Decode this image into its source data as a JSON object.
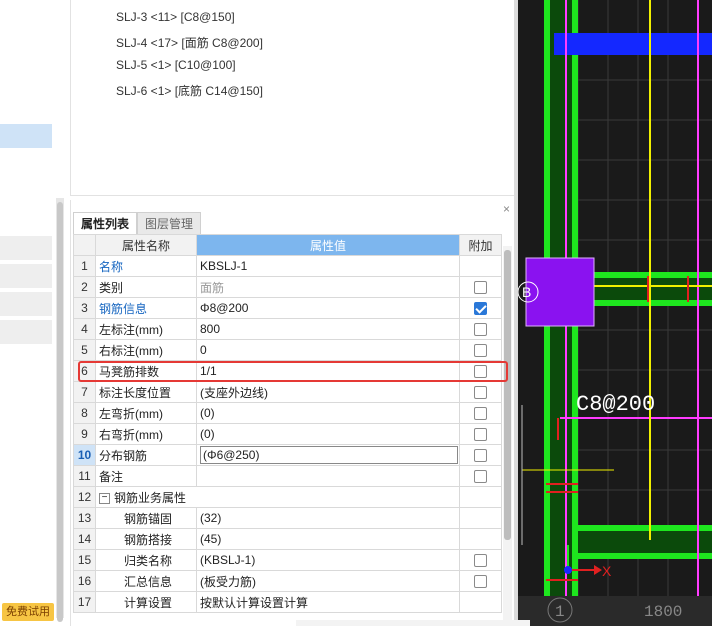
{
  "left_panel": {
    "trial_badge": "免费试用"
  },
  "rebar_list": {
    "items": [
      "SLJ-3 <11> [C8@150]",
      "SLJ-4 <17> [面筋 C8@200]",
      "SLJ-5 <1> [C10@100]",
      "SLJ-6 <1> [底筋 C14@150]"
    ]
  },
  "property_panel": {
    "close_label": "×",
    "tabs": {
      "properties": "属性列表",
      "layers": "图层管理"
    },
    "headers": {
      "name": "属性名称",
      "value": "属性值",
      "extra": "附加"
    },
    "rows": [
      {
        "num": "1",
        "name": "名称",
        "value": "KBSLJ-1",
        "checkbox": "none"
      },
      {
        "num": "2",
        "name": "类别",
        "value": "面筋",
        "checkbox": "unchecked"
      },
      {
        "num": "3",
        "name": "钢筋信息",
        "value": "Φ8@200",
        "checkbox": "checked"
      },
      {
        "num": "4",
        "name": "左标注(mm)",
        "value": "800",
        "checkbox": "unchecked"
      },
      {
        "num": "5",
        "name": "右标注(mm)",
        "value": "0",
        "checkbox": "unchecked"
      },
      {
        "num": "6",
        "name": "马凳筋排数",
        "value": "1/1",
        "checkbox": "unchecked"
      },
      {
        "num": "7",
        "name": "标注长度位置",
        "value": "(支座外边线)",
        "checkbox": "unchecked"
      },
      {
        "num": "8",
        "name": "左弯折(mm)",
        "value": "(0)",
        "checkbox": "unchecked"
      },
      {
        "num": "9",
        "name": "右弯折(mm)",
        "value": "(0)",
        "checkbox": "unchecked"
      },
      {
        "num": "10",
        "name": "分布钢筋",
        "value": "(Φ6@250)",
        "checkbox": "unchecked"
      },
      {
        "num": "11",
        "name": "备注",
        "value": "",
        "checkbox": "unchecked"
      },
      {
        "num": "12",
        "name": "钢筋业务属性",
        "value": "",
        "checkbox": "none"
      },
      {
        "num": "13",
        "name": "钢筋锚固",
        "value": "(32)",
        "checkbox": "none"
      },
      {
        "num": "14",
        "name": "钢筋搭接",
        "value": "(45)",
        "checkbox": "none"
      },
      {
        "num": "15",
        "name": "归类名称",
        "value": "(KBSLJ-1)",
        "checkbox": "unchecked"
      },
      {
        "num": "16",
        "name": "汇总信息",
        "value": "(板受力筋)",
        "checkbox": "unchecked"
      },
      {
        "num": "17",
        "name": "计算设置",
        "value": "按默认计算设置计算",
        "checkbox": "none"
      }
    ],
    "group_toggle": "−"
  },
  "cad_canvas": {
    "rebar_label": "C8@200",
    "node_label": "B",
    "axis_x_label": "X",
    "grid_axis_number": "1",
    "dimension_value": "1800",
    "colors": {
      "background": "#1a1a1a",
      "beam_green": "#1ee61e",
      "rebar_magenta": "#ff3cff",
      "rebar_yellow": "#f0f000",
      "column_purple": "#8a12f0",
      "selection_blue": "#1428ff",
      "dimension_red": "#e02020"
    }
  }
}
